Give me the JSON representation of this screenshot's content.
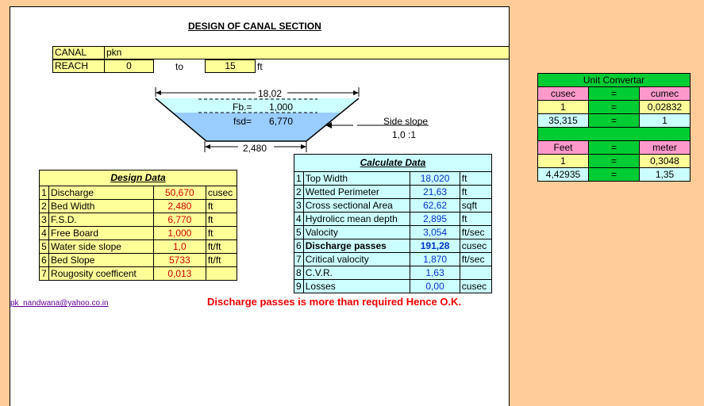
{
  "title": "DESIGN OF CANAL SECTION",
  "canal": {
    "label": "CANAL",
    "value": "pkn"
  },
  "reach": {
    "label": "REACH",
    "from": "0",
    "to_label": "to",
    "to": "15",
    "unit": "ft"
  },
  "diagram": {
    "top_width": "18,02",
    "fb_label": "Fb.=",
    "fb_value": "1,000",
    "fsd_label": "fsd=",
    "fsd_value": "6,770",
    "side_slope_label": "Side slope",
    "side_slope_value": "1,0 :1",
    "bed_width": "2,480"
  },
  "design_data": {
    "heading": "Design Data",
    "rows": [
      {
        "no": "1",
        "label": "Discharge",
        "value": "50,670",
        "unit": "cusec"
      },
      {
        "no": "2",
        "label": "Bed Width",
        "value": "2,480",
        "unit": "ft"
      },
      {
        "no": "3",
        "label": "F.S.D.",
        "value": "6,770",
        "unit": "ft"
      },
      {
        "no": "4",
        "label": "Free Board",
        "value": "1,000",
        "unit": "ft"
      },
      {
        "no": "5",
        "label": "Water side slope",
        "value": "1,0",
        "unit": "ft/ft"
      },
      {
        "no": "6",
        "label": "Bed Slope",
        "value": "5733",
        "unit": "ft/ft"
      },
      {
        "no": "7",
        "label": "Rougosity coefficent",
        "value": "0,013",
        "unit": ""
      }
    ]
  },
  "calculate_data": {
    "heading": "Calculate Data",
    "rows": [
      {
        "no": "1",
        "label": "Top Width",
        "value": "18,020",
        "unit": "ft"
      },
      {
        "no": "2",
        "label": "Wetted Perimeter",
        "value": "21,63",
        "unit": "ft"
      },
      {
        "no": "3",
        "label": "Cross sectional Area",
        "value": "62,62",
        "unit": "sqft"
      },
      {
        "no": "4",
        "label": "Hydrolicc mean depth",
        "value": "2,895",
        "unit": "ft"
      },
      {
        "no": "5",
        "label": "Valocity",
        "value": "3,054",
        "unit": "ft/sec"
      },
      {
        "no": "6",
        "label": "Discharge passes",
        "value": "191,28",
        "unit": "cusec"
      },
      {
        "no": "7",
        "label": "Critical valocity",
        "value": "1,870",
        "unit": "ft/sec"
      },
      {
        "no": "8",
        "label": "C.V.R.",
        "value": "1,63",
        "unit": ""
      },
      {
        "no": "9",
        "label": "Losses",
        "value": "0,00",
        "unit": "cusec"
      }
    ]
  },
  "email": "pk_nandwana@yahoo.co.in",
  "message": "Discharge passes is more than required Hence O.K.",
  "unit_converter": {
    "title": "Unit Convertar",
    "h1": [
      "cusec",
      "=",
      "cumec"
    ],
    "r1": [
      "1",
      "=",
      "0,02832"
    ],
    "r2": [
      "35,315",
      "=",
      "1"
    ],
    "h2": [
      "Feet",
      "=",
      "meter"
    ],
    "r3": [
      "1",
      "=",
      "0,3048"
    ],
    "r4": [
      "4,42935",
      "=",
      "1,35"
    ]
  }
}
